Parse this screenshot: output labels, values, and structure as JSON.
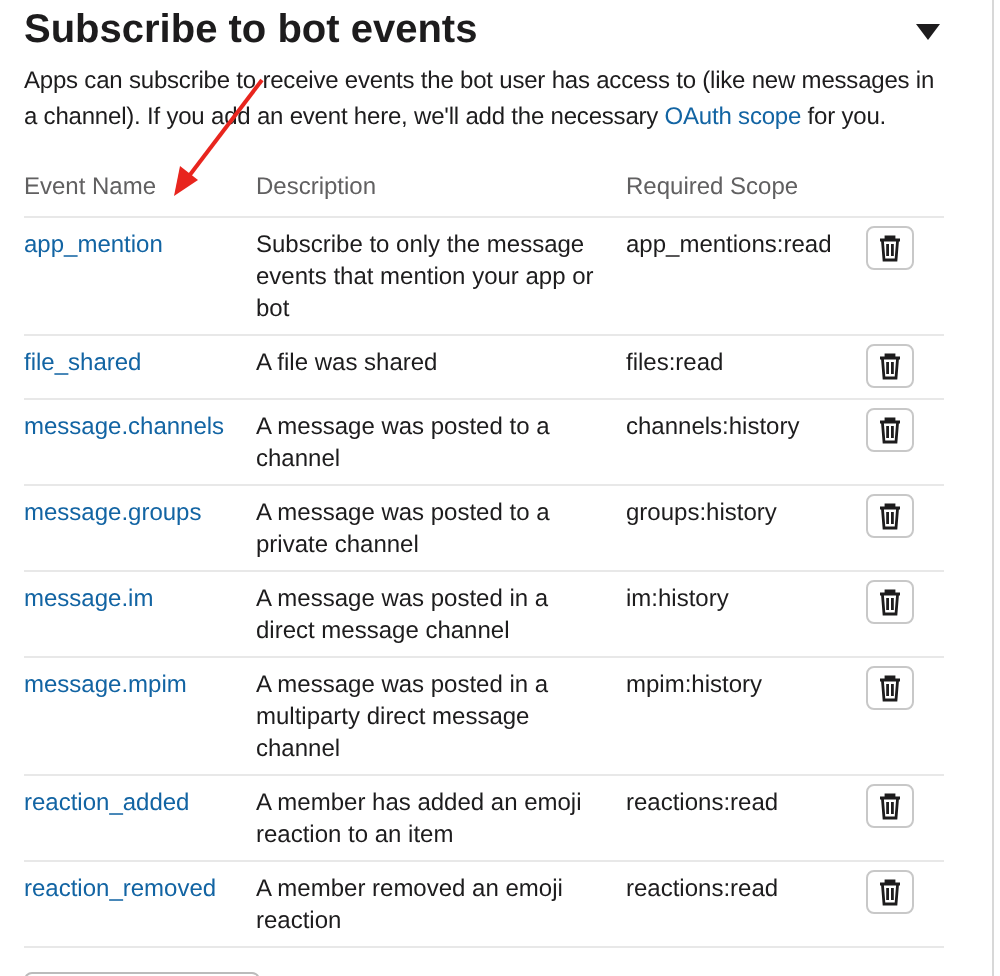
{
  "section": {
    "title": "Subscribe to bot events",
    "expanded": true,
    "description_before": "Apps can subscribe to receive events the bot user has access to (like new messages in a channel). If you add an event here, we'll add the necessary ",
    "description_link": "OAuth scope",
    "description_after": " for you."
  },
  "table": {
    "columns": [
      "Event Name",
      "Description",
      "Required Scope"
    ],
    "rows": [
      {
        "event": "app_mention",
        "description": "Subscribe to only the message events that mention your app or bot",
        "scope": "app_mentions:read"
      },
      {
        "event": "file_shared",
        "description": "A file was shared",
        "scope": "files:read"
      },
      {
        "event": "message.channels",
        "description": "A message was posted to a channel",
        "scope": "channels:history"
      },
      {
        "event": "message.groups",
        "description": "A message was posted to a private channel",
        "scope": "groups:history"
      },
      {
        "event": "message.im",
        "description": "A message was posted in a direct message channel",
        "scope": "im:history"
      },
      {
        "event": "message.mpim",
        "description": "A message was posted in a multiparty direct message channel",
        "scope": "mpim:history"
      },
      {
        "event": "reaction_added",
        "description": "A member has added an emoji reaction to an item",
        "scope": "reactions:read"
      },
      {
        "event": "reaction_removed",
        "description": "A member removed an emoji reaction",
        "scope": "reactions:read"
      }
    ]
  }
}
